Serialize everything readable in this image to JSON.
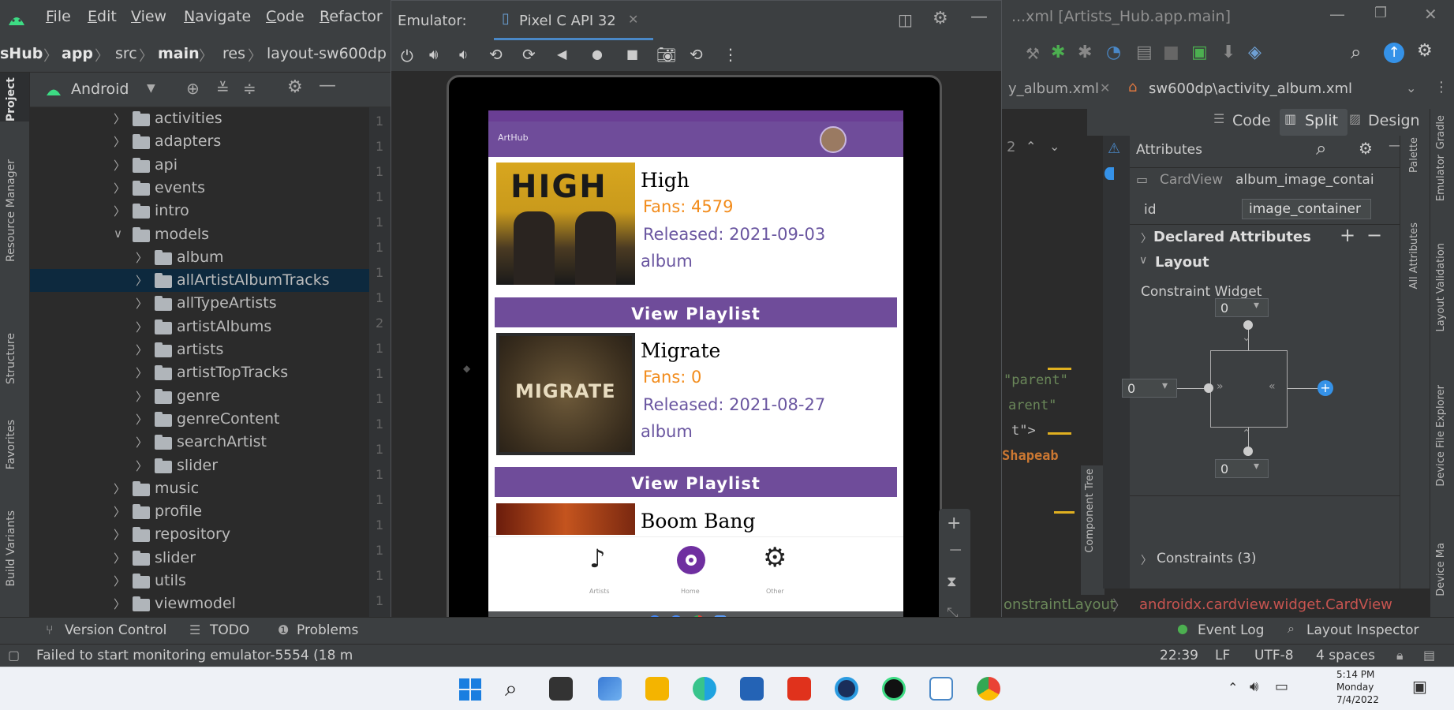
{
  "ide": {
    "title": "...xml [Artists_Hub.app.main]",
    "menu": [
      "File",
      "Edit",
      "View",
      "Navigate",
      "Code",
      "Refactor"
    ],
    "breadcrumb": [
      "sHub",
      "app",
      "src",
      "main",
      "res",
      "layout-sw600dp"
    ],
    "project_view": "Android",
    "left_tool_tabs": [
      "Project",
      "Resource Manager",
      "Structure",
      "Favorites",
      "Build Variants"
    ],
    "tree": [
      {
        "label": "activities",
        "level": 1
      },
      {
        "label": "adapters",
        "level": 1
      },
      {
        "label": "api",
        "level": 1
      },
      {
        "label": "events",
        "level": 1
      },
      {
        "label": "intro",
        "level": 1
      },
      {
        "label": "models",
        "level": 1,
        "expanded": true
      },
      {
        "label": "album",
        "level": 2
      },
      {
        "label": "allArtistAlbumTracks",
        "level": 2,
        "selected": true
      },
      {
        "label": "allTypeArtists",
        "level": 2
      },
      {
        "label": "artistAlbums",
        "level": 2
      },
      {
        "label": "artists",
        "level": 2
      },
      {
        "label": "artistTopTracks",
        "level": 2
      },
      {
        "label": "genre",
        "level": 2
      },
      {
        "label": "genreContent",
        "level": 2
      },
      {
        "label": "searchArtist",
        "level": 2
      },
      {
        "label": "slider",
        "level": 2
      },
      {
        "label": "music",
        "level": 1
      },
      {
        "label": "profile",
        "level": 1
      },
      {
        "label": "repository",
        "level": 1
      },
      {
        "label": "slider",
        "level": 1
      },
      {
        "label": "utils",
        "level": 1
      },
      {
        "label": "viewmodel",
        "level": 1
      }
    ],
    "editor_tabs": [
      "y_album.xml",
      "sw600dp\\activity_album.xml"
    ],
    "view_modes": [
      "Code",
      "Split",
      "Design"
    ],
    "code_snippets": [
      "\"parent\"",
      "arent\"",
      "t\">",
      "Shapeab"
    ],
    "attributes": {
      "title": "Attributes",
      "component": "CardView",
      "component_id": "album_image_contai",
      "id_label": "id",
      "id_value": "image_container",
      "declared": "Declared Attributes",
      "layout": "Layout",
      "constraint_widget": "Constraint Widget",
      "margin_top": "0",
      "margin_left": "0",
      "margin_bottom": "0",
      "constraints": "Constraints (3)"
    },
    "right_tool_tabs": [
      "Gradle",
      "Emulator",
      "Layout Validation",
      "Device File Explorer",
      "Device Ma"
    ],
    "attr_side_tabs": [
      "Palette",
      "All Attributes"
    ],
    "component_tree_label": "Component Tree",
    "path": [
      "onstraintLayout",
      "androidx.cardview.widget.CardView"
    ],
    "bottom_tabs": [
      "Version Control",
      "TODO",
      "Problems"
    ],
    "bottom_tabs_right": [
      "Event Log",
      "Layout Inspector"
    ],
    "status_message": "Failed to start monitoring emulator-5554 (18 m",
    "status_right": [
      "22:39",
      "LF",
      "UTF-8",
      "4 spaces"
    ]
  },
  "emulator": {
    "label": "Emulator:",
    "device_tab": "Pixel C API 32",
    "screen": {
      "app_label": "ArtHub",
      "albums": [
        {
          "title": "High",
          "fans": "Fans: 4579",
          "released": "Released: 2021-09-03",
          "type": "album",
          "button": "View Playlist",
          "art_text": "HIGH",
          "art_color": "#c99a1c"
        },
        {
          "title": "Migrate",
          "fans": "Fans: 0",
          "released": "Released: 2021-08-27",
          "type": "album",
          "button": "View Playlist",
          "art_text": "MIGRATE",
          "art_color": "#4a3b26"
        },
        {
          "title": "Boom Bang",
          "art_color": "#8a2a12"
        }
      ],
      "bottom_nav": [
        {
          "icon": "music-note-icon",
          "label": "Artists"
        },
        {
          "icon": "album-disc-icon",
          "label": "Home"
        },
        {
          "icon": "gear-icon",
          "label": "Other"
        }
      ]
    }
  },
  "taskbar": {
    "time": "5:14 PM",
    "day": "Monday",
    "date": "7/4/2022"
  },
  "colors": {
    "app_purple": "#6f4c9a",
    "fans_orange": "#f28c1c",
    "release_purple": "#6a56a0",
    "ide_panel": "#3c3f41",
    "ide_editor": "#2b2b2b",
    "selection": "#0d293e"
  }
}
